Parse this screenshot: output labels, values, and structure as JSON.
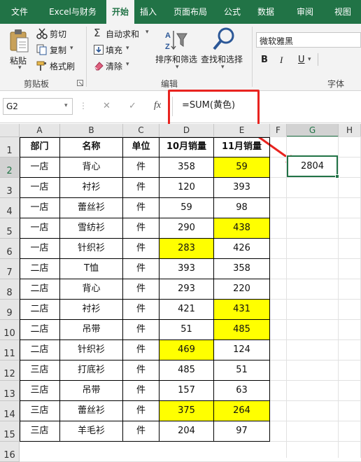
{
  "tabs": [
    {
      "label": "文件",
      "active": false
    },
    {
      "label": "Excel与财务",
      "active": false
    },
    {
      "label": "开始",
      "active": true
    },
    {
      "label": "插入",
      "active": false
    },
    {
      "label": "页面布局",
      "active": false
    },
    {
      "label": "公式",
      "active": false
    },
    {
      "label": "数据",
      "active": false
    },
    {
      "label": "审阅",
      "active": false
    },
    {
      "label": "视图",
      "active": false
    }
  ],
  "ribbon": {
    "paste": "粘贴",
    "cut": "剪切",
    "copy": "复制",
    "format_painter": "格式刷",
    "clipboard_group": "剪贴板",
    "autosum": "自动求和",
    "fill": "填充",
    "clear": "清除",
    "sort_filter": "排序和筛选",
    "find_select": "查找和选择",
    "editing_group": "编辑",
    "font_name": "微软雅黑",
    "bold": "B",
    "italic": "I",
    "underline": "U",
    "font_group": "字体"
  },
  "formula_bar": {
    "name_box": "G2",
    "cancel": "✕",
    "enter": "✓",
    "fx": "fx",
    "formula": "=SUM(黄色)"
  },
  "columns": [
    "A",
    "B",
    "C",
    "D",
    "E",
    "F",
    "G",
    "H"
  ],
  "selected_column": "G",
  "rows": [
    "1",
    "2",
    "3",
    "4",
    "5",
    "6",
    "7",
    "8",
    "9",
    "10",
    "11",
    "12",
    "13",
    "14",
    "15",
    "16"
  ],
  "selected_row": "2",
  "table": {
    "header": [
      "部门",
      "名称",
      "单位",
      "10月销量",
      "11月销量"
    ],
    "rows": [
      {
        "dept": "一店",
        "name": "背心",
        "unit": "件",
        "oct": "358",
        "nov": "59",
        "oct_yellow": false,
        "nov_yellow": true
      },
      {
        "dept": "一店",
        "name": "衬衫",
        "unit": "件",
        "oct": "120",
        "nov": "393",
        "oct_yellow": false,
        "nov_yellow": false
      },
      {
        "dept": "一店",
        "name": "蕾丝衫",
        "unit": "件",
        "oct": "59",
        "nov": "98",
        "oct_yellow": false,
        "nov_yellow": false
      },
      {
        "dept": "一店",
        "name": "雪纺衫",
        "unit": "件",
        "oct": "290",
        "nov": "438",
        "oct_yellow": false,
        "nov_yellow": true
      },
      {
        "dept": "一店",
        "name": "针织衫",
        "unit": "件",
        "oct": "283",
        "nov": "426",
        "oct_yellow": true,
        "nov_yellow": false
      },
      {
        "dept": "二店",
        "name": "T恤",
        "unit": "件",
        "oct": "393",
        "nov": "358",
        "oct_yellow": false,
        "nov_yellow": false
      },
      {
        "dept": "二店",
        "name": "背心",
        "unit": "件",
        "oct": "293",
        "nov": "220",
        "oct_yellow": false,
        "nov_yellow": false
      },
      {
        "dept": "二店",
        "name": "衬衫",
        "unit": "件",
        "oct": "421",
        "nov": "431",
        "oct_yellow": false,
        "nov_yellow": true
      },
      {
        "dept": "二店",
        "name": "吊带",
        "unit": "件",
        "oct": "51",
        "nov": "485",
        "oct_yellow": false,
        "nov_yellow": true
      },
      {
        "dept": "二店",
        "name": "针织衫",
        "unit": "件",
        "oct": "469",
        "nov": "124",
        "oct_yellow": true,
        "nov_yellow": false
      },
      {
        "dept": "三店",
        "name": "打底衫",
        "unit": "件",
        "oct": "485",
        "nov": "51",
        "oct_yellow": false,
        "nov_yellow": false
      },
      {
        "dept": "三店",
        "name": "吊带",
        "unit": "件",
        "oct": "157",
        "nov": "63",
        "oct_yellow": false,
        "nov_yellow": false
      },
      {
        "dept": "三店",
        "name": "蕾丝衫",
        "unit": "件",
        "oct": "375",
        "nov": "264",
        "oct_yellow": true,
        "nov_yellow": true
      },
      {
        "dept": "三店",
        "name": "羊毛衫",
        "unit": "件",
        "oct": "204",
        "nov": "97",
        "oct_yellow": false,
        "nov_yellow": false
      }
    ]
  },
  "g2_value": "2804",
  "colors": {
    "accent": "#217346",
    "highlight": "#ffff00",
    "callout": "#e8231f"
  }
}
